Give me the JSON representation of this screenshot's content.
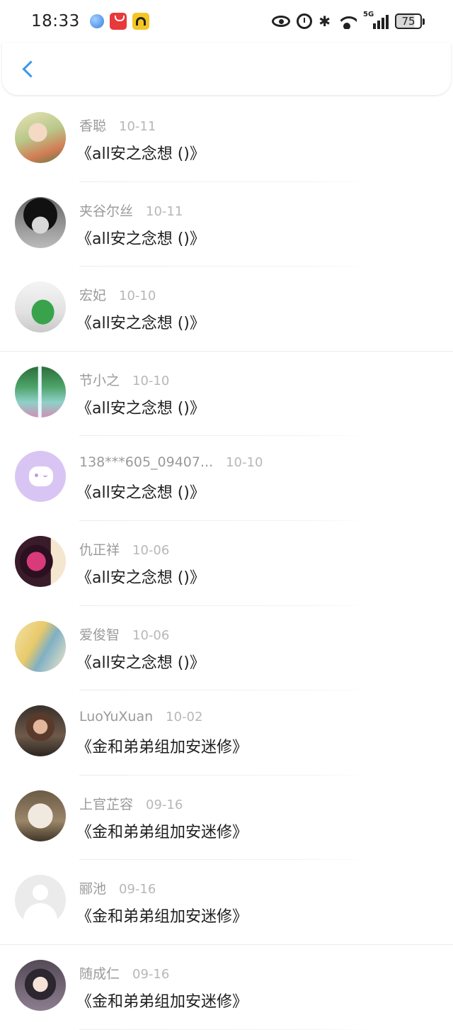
{
  "status_bar": {
    "time": "18:33",
    "network": "5G",
    "battery": "75"
  },
  "header": {
    "back_icon": "chevron-left-icon",
    "accent_color": "#3b97ea"
  },
  "items": [
    {
      "name": "香聪",
      "date": "10-11",
      "title": "《all安之念想 ()》",
      "avatar": "av0"
    },
    {
      "name": "夹谷尔丝",
      "date": "10-11",
      "title": "《all安之念想 ()》",
      "avatar": "av1"
    },
    {
      "name": "宏妃",
      "date": "10-10",
      "title": "《all安之念想 ()》",
      "avatar": "av2"
    },
    {
      "name": "节小之",
      "date": "10-10",
      "title": "《all安之念想 ()》",
      "avatar": "av3"
    },
    {
      "name": "138***605_09407...",
      "date": "10-10",
      "title": "《all安之念想 ()》",
      "avatar": "av4"
    },
    {
      "name": "仇正祥",
      "date": "10-06",
      "title": "《all安之念想 ()》",
      "avatar": "av5"
    },
    {
      "name": "爱俊智",
      "date": "10-06",
      "title": "《all安之念想 ()》",
      "avatar": "av6"
    },
    {
      "name": "LuoYuXuan",
      "date": "10-02",
      "title": "《金和弟弟组加安迷修》",
      "avatar": "av7"
    },
    {
      "name": "上官芷容",
      "date": "09-16",
      "title": "《金和弟弟组加安迷修》",
      "avatar": "av8"
    },
    {
      "name": "郦池",
      "date": "09-16",
      "title": "《金和弟弟组加安迷修》",
      "avatar": "av9"
    },
    {
      "name": "随成仁",
      "date": "09-16",
      "title": "《金和弟弟组加安迷修》",
      "avatar": "av10"
    }
  ]
}
